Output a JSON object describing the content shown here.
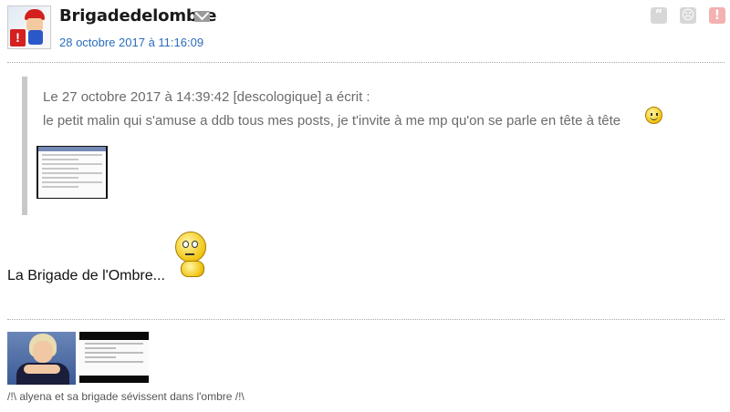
{
  "post": {
    "author": "Brigadedelombre",
    "timestamp": "28 octobre 2017 à 11:16:09",
    "actions": {
      "quote_symbol": "”",
      "sad_symbol": "☹",
      "report_symbol": "!"
    },
    "quote": {
      "header": "Le 27 octobre 2017 à 14:39:42 [descologique] a écrit :",
      "text": "le petit malin qui s'amuse a ddb tous mes posts, je t'invite à me mp qu'on se parle en tête à tête"
    },
    "body_text": "La Brigade de l'Ombre...",
    "signature": {
      "caption": "/!\\ alyena et sa brigade sévissent dans l'ombre /!\\"
    }
  },
  "icons": {
    "avatar": "avatar-icon",
    "mail": "mail-icon",
    "quote": "quote-icon",
    "sad": "sad-face-icon",
    "report": "report-icon",
    "smiley": "smiley-icon",
    "thinking": "thinking-smiley-icon"
  },
  "colors": {
    "author_link": "#1a1a1a",
    "timestamp": "#2a6ebb",
    "quote_text": "#6b6b6b",
    "report": "#f3b1b1"
  }
}
